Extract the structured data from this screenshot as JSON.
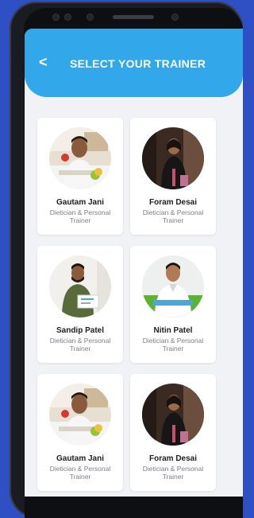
{
  "header": {
    "back_symbol": "<",
    "title": "SELECT YOUR TRAINER"
  },
  "trainers": [
    {
      "name": "Gautam Jani",
      "role": "Dietician & Personal Trainer",
      "photo": "man-with-fruits"
    },
    {
      "name": "Foram Desai",
      "role": "Dietician & Personal Trainer",
      "photo": "woman-dark-background"
    },
    {
      "name": "Sandip Patel",
      "role": "Dietician & Personal Trainer",
      "photo": "man-holding-certificate"
    },
    {
      "name": "Nitin Patel",
      "role": "Dietician & Personal Trainer",
      "photo": "man-white-shirt"
    },
    {
      "name": "Gautam Jani",
      "role": "Dietician & Personal Trainer",
      "photo": "man-with-fruits"
    },
    {
      "name": "Foram Desai",
      "role": "Dietician & Personal Trainer",
      "photo": "woman-dark-background"
    }
  ],
  "colors": {
    "background": "#2f4fc4",
    "header": "#32a8ea",
    "screen": "#f0f2f5",
    "card": "#ffffff",
    "name_text": "#1d1d1f",
    "role_text": "#7a7f86"
  }
}
